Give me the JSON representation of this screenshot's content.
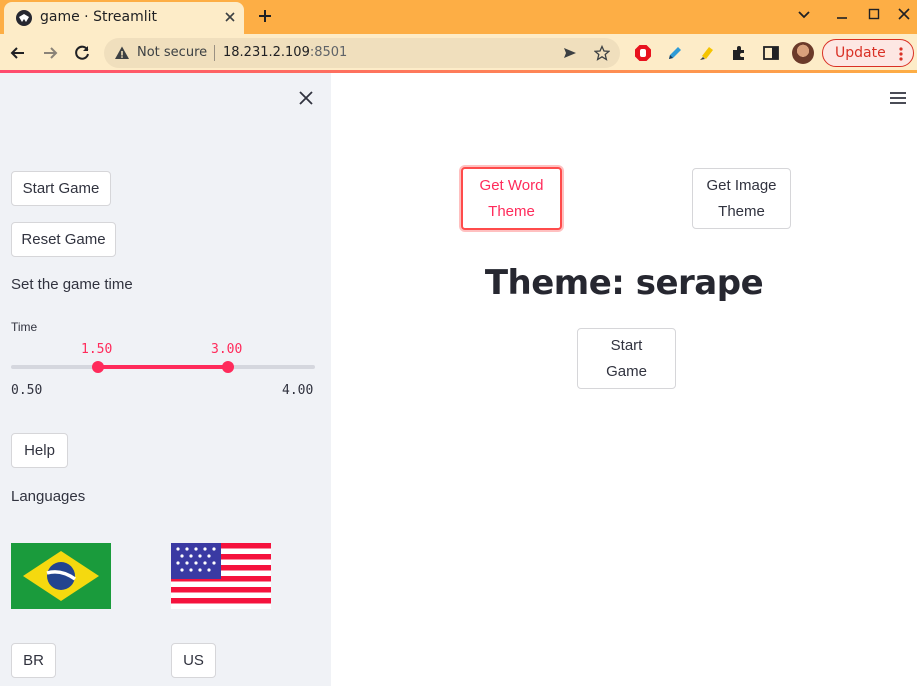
{
  "browser": {
    "tab_title": "game · Streamlit",
    "omnibox": {
      "security_label": "Not secure",
      "url_host": "18.231.2.109",
      "url_port": ":8501"
    },
    "update_label": "Update",
    "icons": [
      "back-arrow-icon",
      "forward-arrow-icon",
      "reload-icon",
      "warning-icon",
      "send-icon",
      "star-icon",
      "adblock-icon",
      "pen-icon",
      "highlighter-icon",
      "puzzle-icon",
      "sidepanel-icon",
      "avatar",
      "more-icon"
    ]
  },
  "sidebar": {
    "start_game_label": "Start Game",
    "reset_game_label": "Reset Game",
    "game_time_heading": "Set the game time",
    "slider": {
      "label": "Time",
      "min": "0.50",
      "max": "4.00",
      "low_value": "1.50",
      "high_value": "3.00",
      "range": [
        0.5,
        4.0
      ],
      "selected": [
        1.5,
        3.0
      ]
    },
    "help_label": "Help",
    "languages_heading": "Languages",
    "languages": [
      {
        "code": "BR",
        "flag": "brazil-flag"
      },
      {
        "code": "US",
        "flag": "us-flag"
      }
    ]
  },
  "main": {
    "word_theme_label_1": "Get Word",
    "word_theme_label_2": "Theme",
    "image_theme_label_1": "Get Image",
    "image_theme_label_2": "Theme",
    "theme_title": "Theme: serape",
    "start_game_label_1": "Start",
    "start_game_label_2": "Game"
  },
  "colors": {
    "accent": "#ff2b5b",
    "sidebar_bg": "#f0f2f6",
    "tabbar": "#fdae45",
    "text": "#31333f"
  }
}
